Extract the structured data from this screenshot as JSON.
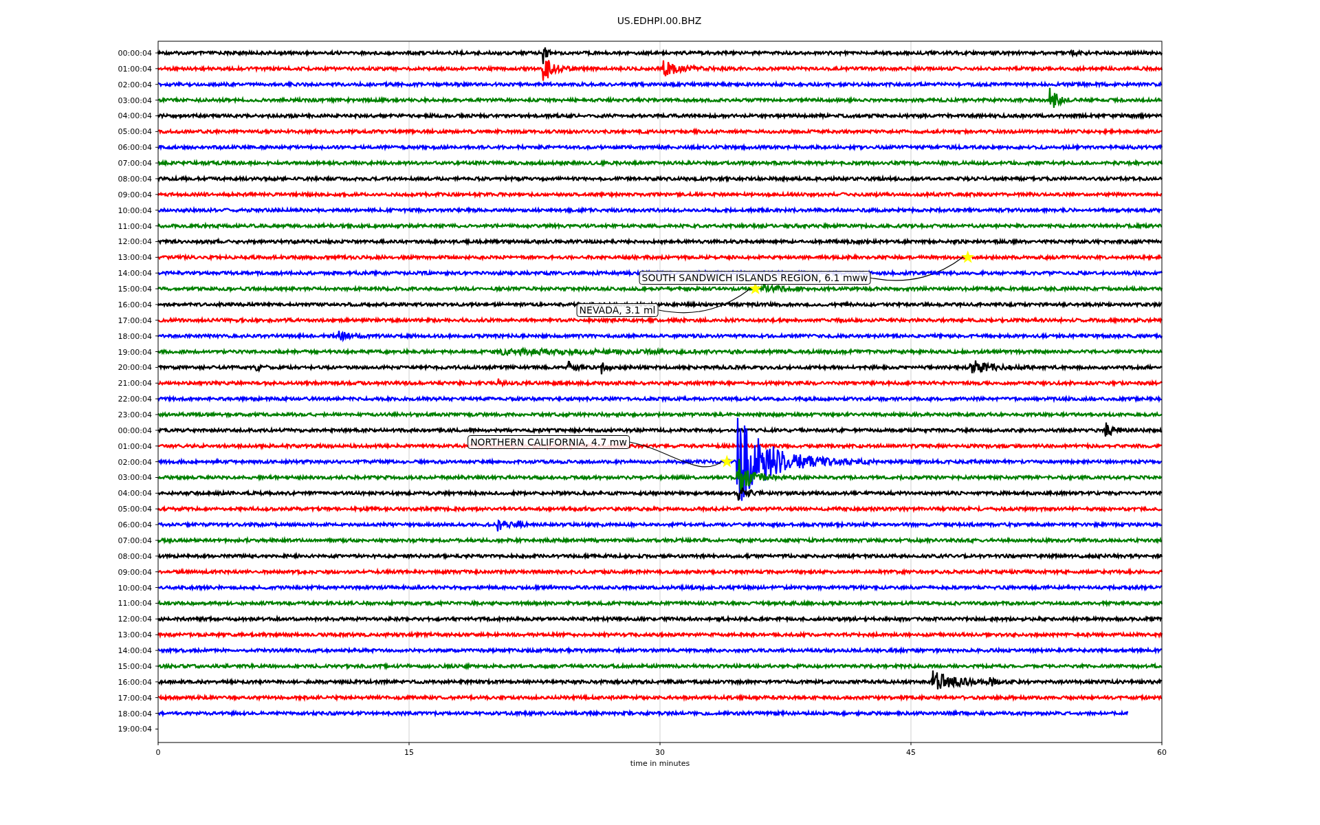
{
  "title": "US.EDHPI.00.BHZ",
  "axis": {
    "xlabel": "time in minutes",
    "xticks": [
      "0",
      "15",
      "30",
      "45",
      "60"
    ]
  },
  "rows": [
    {
      "label": "00:00:04",
      "color": "#000000",
      "kind": "trace"
    },
    {
      "label": "01:00:04",
      "color": "#ff0000",
      "kind": "trace"
    },
    {
      "label": "02:00:04",
      "color": "#0000ff",
      "kind": "trace"
    },
    {
      "label": "03:00:04",
      "color": "#008000",
      "kind": "trace"
    },
    {
      "label": "04:00:04",
      "color": "#000000",
      "kind": "trace"
    },
    {
      "label": "05:00:04",
      "color": "#ff0000",
      "kind": "trace"
    },
    {
      "label": "06:00:04",
      "color": "#0000ff",
      "kind": "trace"
    },
    {
      "label": "07:00:04",
      "color": "#008000",
      "kind": "trace"
    },
    {
      "label": "08:00:04",
      "color": "#000000",
      "kind": "trace"
    },
    {
      "label": "09:00:04",
      "color": "#ff0000",
      "kind": "trace"
    },
    {
      "label": "10:00:04",
      "color": "#0000ff",
      "kind": "trace"
    },
    {
      "label": "11:00:04",
      "color": "#008000",
      "kind": "trace"
    },
    {
      "label": "12:00:04",
      "color": "#000000",
      "kind": "trace"
    },
    {
      "label": "13:00:04",
      "color": "#ff0000",
      "kind": "trace",
      "event": {
        "label": "SOUTH SANDWICH ISLANDS REGION, 6.1 mww"
      }
    },
    {
      "label": "14:00:04",
      "color": "#0000ff",
      "kind": "trace"
    },
    {
      "label": "15:00:04",
      "color": "#008000",
      "kind": "trace",
      "event": {
        "label": "NEVADA, 3.1 ml"
      }
    },
    {
      "label": "16:00:04",
      "color": "#000000",
      "kind": "trace"
    },
    {
      "label": "17:00:04",
      "color": "#ff0000",
      "kind": "trace"
    },
    {
      "label": "18:00:04",
      "color": "#0000ff",
      "kind": "trace"
    },
    {
      "label": "19:00:04",
      "color": "#008000",
      "kind": "trace"
    },
    {
      "label": "20:00:04",
      "color": "#000000",
      "kind": "trace"
    },
    {
      "label": "21:00:04",
      "color": "#ff0000",
      "kind": "trace"
    },
    {
      "label": "22:00:04",
      "color": "#0000ff",
      "kind": "trace"
    },
    {
      "label": "23:00:04",
      "color": "#008000",
      "kind": "trace"
    },
    {
      "label": "00:00:04",
      "color": "#000000",
      "kind": "trace"
    },
    {
      "label": "01:00:04",
      "color": "#ff0000",
      "kind": "trace"
    },
    {
      "label": "02:00:04",
      "color": "#0000ff",
      "kind": "trace",
      "event": {
        "label": "NORTHERN CALIFORNIA, 4.7 mw"
      }
    },
    {
      "label": "03:00:04",
      "color": "#008000",
      "kind": "trace"
    },
    {
      "label": "04:00:04",
      "color": "#000000",
      "kind": "trace"
    },
    {
      "label": "05:00:04",
      "color": "#ff0000",
      "kind": "trace"
    },
    {
      "label": "06:00:04",
      "color": "#0000ff",
      "kind": "trace"
    },
    {
      "label": "07:00:04",
      "color": "#008000",
      "kind": "trace"
    },
    {
      "label": "08:00:04",
      "color": "#000000",
      "kind": "trace"
    },
    {
      "label": "09:00:04",
      "color": "#ff0000",
      "kind": "trace"
    },
    {
      "label": "10:00:04",
      "color": "#0000ff",
      "kind": "trace"
    },
    {
      "label": "11:00:04",
      "color": "#008000",
      "kind": "trace"
    },
    {
      "label": "12:00:04",
      "color": "#000000",
      "kind": "trace"
    },
    {
      "label": "13:00:04",
      "color": "#ff0000",
      "kind": "trace"
    },
    {
      "label": "14:00:04",
      "color": "#0000ff",
      "kind": "trace"
    },
    {
      "label": "15:00:04",
      "color": "#008000",
      "kind": "trace"
    },
    {
      "label": "16:00:04",
      "color": "#000000",
      "kind": "trace"
    },
    {
      "label": "17:00:04",
      "color": "#ff0000",
      "kind": "trace"
    },
    {
      "label": "18:00:04",
      "color": "#0000ff",
      "kind": "partial"
    },
    {
      "label": "19:00:04",
      "kind": "empty"
    }
  ]
}
